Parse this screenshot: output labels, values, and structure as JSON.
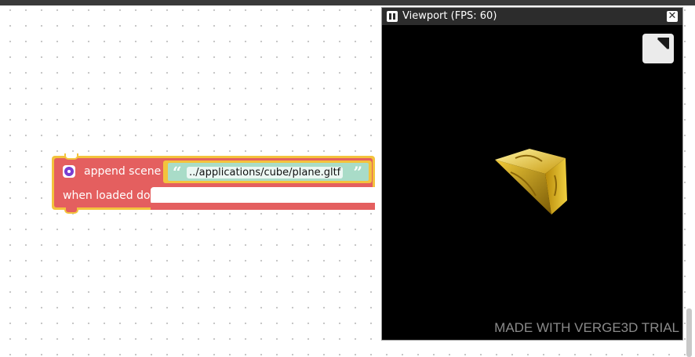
{
  "block": {
    "label_append": "append scene",
    "label_when": "when loaded do",
    "url": "../applications/cube/plane.gltf",
    "open_quote": "“",
    "close_quote": "”"
  },
  "viewport": {
    "title": "Viewport (FPS: 60)",
    "close_glyph": "✕",
    "watermark": "MADE WITH VERGE3D TRIAL"
  },
  "colors": {
    "block": "#e45f5f",
    "block_outline": "#f3c33d",
    "string_block": "#a9dcc8",
    "gold": "#d4a817"
  }
}
